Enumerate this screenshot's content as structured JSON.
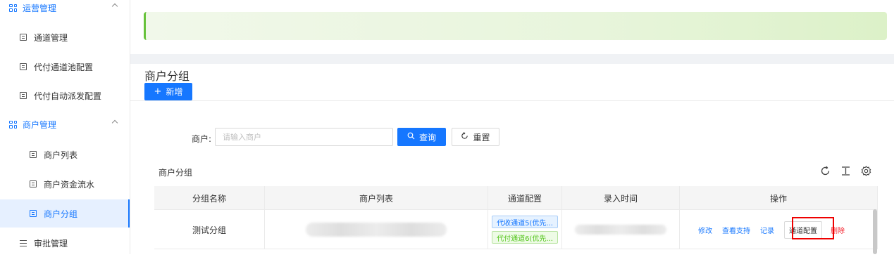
{
  "sidebar": {
    "group_ops": "运营管理",
    "items_ops": [
      "通道管理",
      "代付通道池配置",
      "代付自动派发配置"
    ],
    "group_merchant": "商户管理",
    "items_merchant": [
      "商户列表",
      "商户资金流水",
      "商户分组"
    ],
    "active_item": "商户分组",
    "group_approval": "审批管理"
  },
  "page": {
    "title": "商户分组",
    "add_label": "新增"
  },
  "search": {
    "label": "商户:",
    "placeholder": "请输入商户",
    "value": "",
    "query_label": "查询",
    "reset_label": "重置"
  },
  "table": {
    "title": "商户分组",
    "columns": [
      "分组名称",
      "商户列表",
      "通道配置",
      "录入时间",
      "操作"
    ],
    "rows": [
      {
        "group_name": "测试分组",
        "channels": [
          "代收通道5(优先...",
          "代付通道6(优先..."
        ],
        "actions": [
          "修改",
          "查看支持",
          "记录",
          "通道配置",
          "删除"
        ]
      }
    ]
  },
  "icons": {
    "refresh": "refresh-icon",
    "density": "column-height-icon",
    "settings": "setting-icon"
  },
  "colors": {
    "primary": "#1677ff",
    "danger": "#f5222d",
    "success": "#67c23a",
    "highlight": "#e00000"
  }
}
